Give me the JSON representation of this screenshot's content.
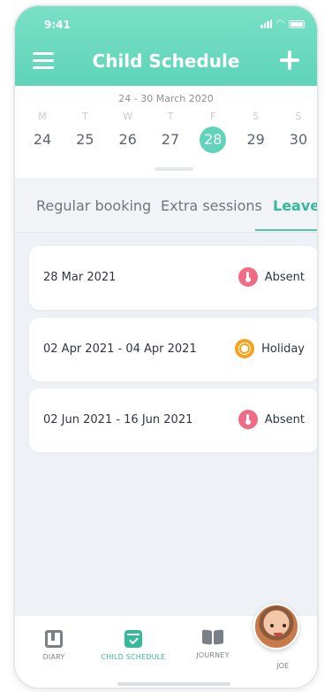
{
  "status_bar": {
    "time": "9:41"
  },
  "header": {
    "title": "Child Schedule"
  },
  "calendar": {
    "range": "24 - 30 March 2020",
    "weekdays": [
      "M",
      "T",
      "W",
      "T",
      "F",
      "S",
      "S"
    ],
    "days": [
      "24",
      "25",
      "26",
      "27",
      "28",
      "29",
      "30"
    ],
    "selected_day": "28"
  },
  "tabs": [
    {
      "label": "Regular booking"
    },
    {
      "label": "Extra sessions"
    },
    {
      "label": "Leave"
    }
  ],
  "leave_items": [
    {
      "date": "28 Mar 2021",
      "status": "Absent",
      "icon": "thermometer-icon",
      "color": "#ef6b86"
    },
    {
      "date": "02 Apr 2021 - 04 Apr 2021",
      "status": "Holiday",
      "icon": "sun-icon",
      "color": "#f6a21b"
    },
    {
      "date": "02 Jun 2021 - 16 Jun 2021",
      "status": "Absent",
      "icon": "thermometer-icon",
      "color": "#ef6b86"
    }
  ],
  "bottom_nav": [
    {
      "label": "DIARY",
      "icon": "diary-icon"
    },
    {
      "label": "CHILD SCHEDULE",
      "icon": "calendar-check-icon"
    },
    {
      "label": "JOURNEY",
      "icon": "book-icon"
    },
    {
      "label": "JOE",
      "icon": "avatar"
    }
  ],
  "colors": {
    "accent": "#5fd4b8",
    "active_tab": "#33b99b"
  }
}
